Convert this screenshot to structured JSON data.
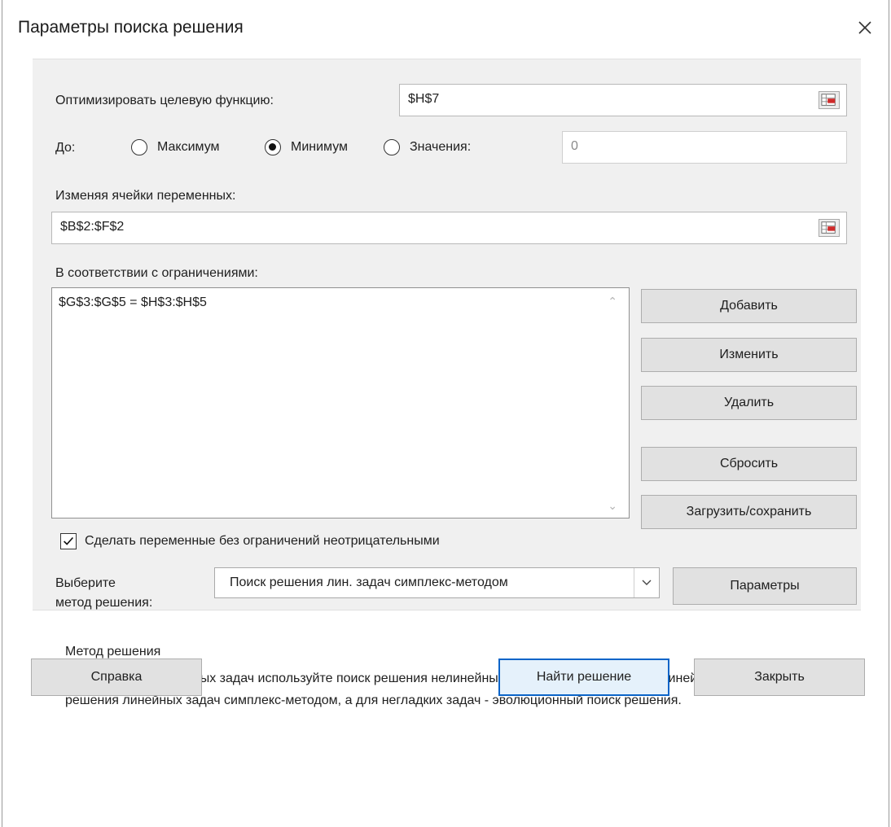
{
  "dialog": {
    "title": "Параметры поиска решения"
  },
  "objective": {
    "label": "Оптимизировать целевую функцию:",
    "value": "$H$7"
  },
  "to": {
    "label": "До:",
    "options": [
      {
        "label": "Максимум",
        "selected": false
      },
      {
        "label": "Минимум",
        "selected": true
      },
      {
        "label": "Значения:",
        "selected": false
      }
    ],
    "value_field": "0"
  },
  "variables": {
    "label": "Изменяя ячейки переменных:",
    "value": "$B$2:$F$2"
  },
  "constraints": {
    "label": "В соответствии с ограничениями:",
    "items": [
      "$G$3:$G$5 = $H$3:$H$5"
    ]
  },
  "side_buttons": {
    "add": "Добавить",
    "change": "Изменить",
    "delete": "Удалить",
    "reset": "Сбросить",
    "load_save": "Загрузить/сохранить"
  },
  "nonneg": {
    "label": "Сделать переменные без ограничений неотрицательными",
    "checked": true
  },
  "method": {
    "label_line1": "Выберите",
    "label_line2": "метод решения:",
    "selected": "Поиск решения лин. задач симплекс-методом",
    "options_button": "Параметры"
  },
  "method_info": {
    "title": "Метод решения",
    "text": "Для гладких нелинейных задач используйте поиск решения нелинейных задач методом ОПГ, для линейных задач - поиск решения линейных задач симплекс-методом, а для негладких задач - эволюционный поиск решения."
  },
  "footer": {
    "help": "Справка",
    "solve": "Найти решение",
    "close": "Закрыть"
  },
  "icons": {
    "close": "close-icon",
    "collapse": "range-collapse-icon",
    "check": "checkmark-icon",
    "dropdown": "chevron-down-icon",
    "scroll_up": "scroll-up-icon",
    "scroll_down": "scroll-down-icon"
  },
  "colors": {
    "panel": "#f0f0f0",
    "primary_border": "#0a64c8"
  }
}
